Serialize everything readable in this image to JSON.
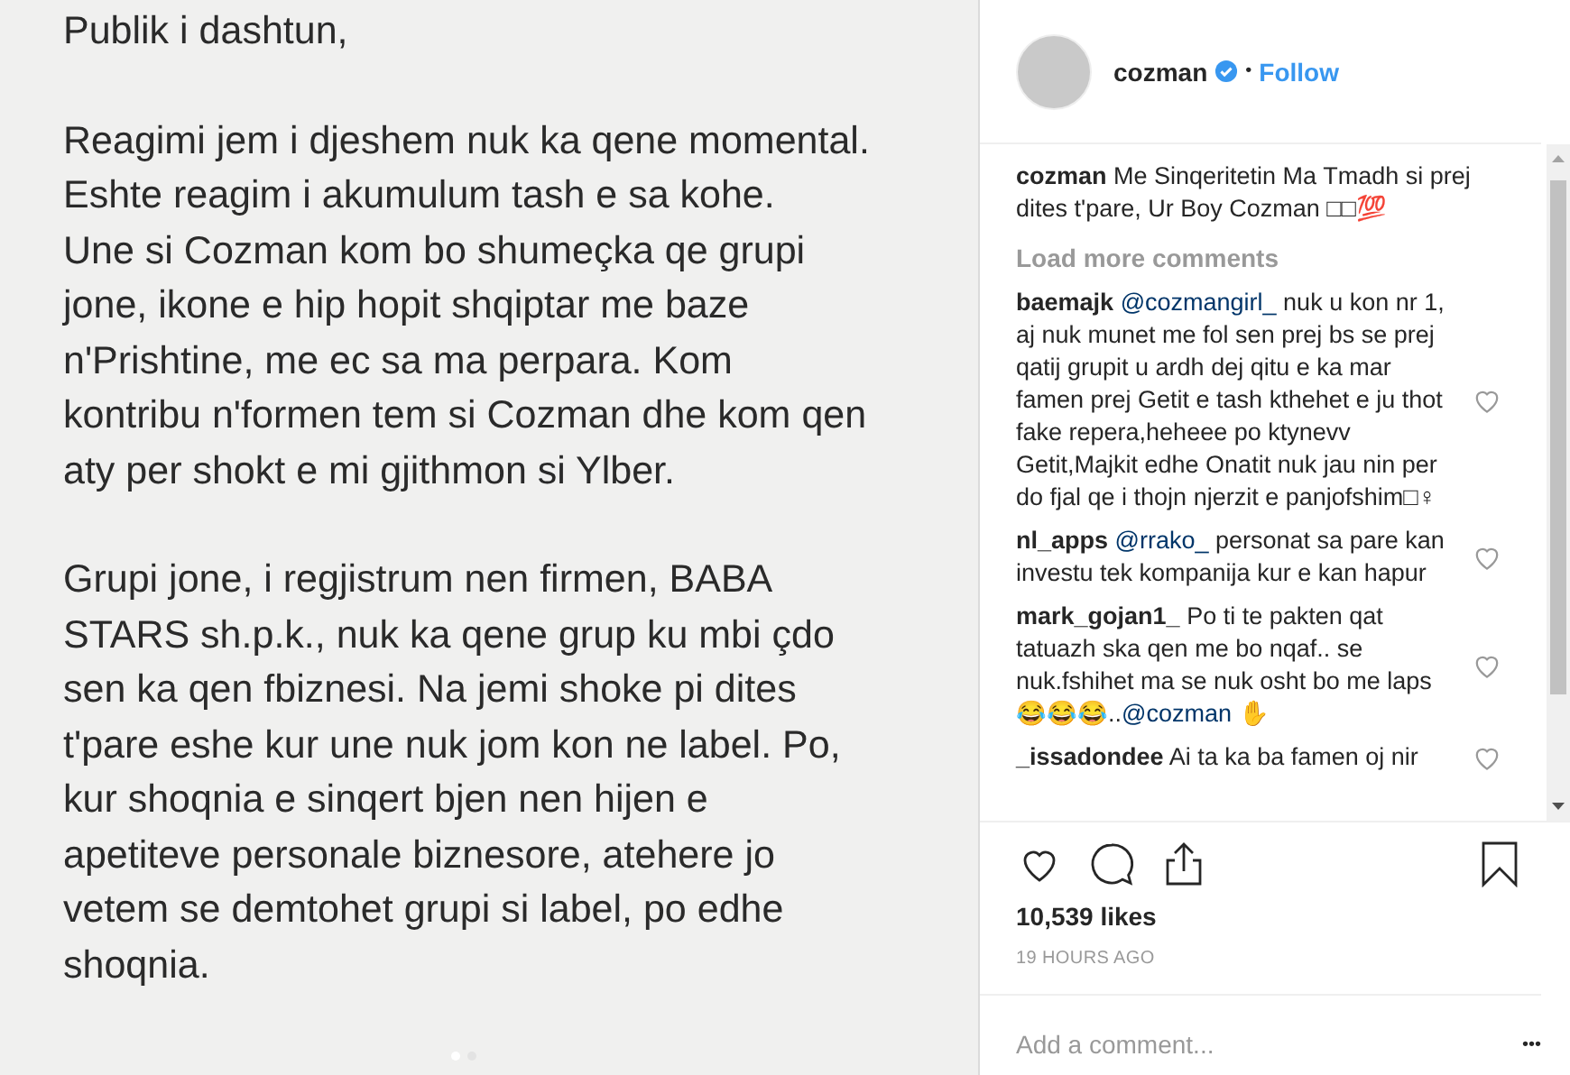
{
  "note": {
    "paragraphs": [
      [
        "Publik i dashtun,"
      ],
      [
        "Reagimi jem i djeshem nuk ka qene momental.",
        "Eshte reagim i akumulum tash e sa kohe.",
        "Une si Cozman kom bo shumeçka qe grupi",
        "jone, ikone e hip hopit shqiptar me baze",
        "n'Prishtine, me ec sa ma perpara. Kom",
        "kontribu n'formen tem si Cozman dhe kom qen",
        "aty per shokt e mi gjithmon si Ylber."
      ],
      [
        "Grupi jone, i regjistrum nen firmen, BABA",
        "STARS sh.p.k., nuk ka qene grup ku mbi çdo",
        "sen ka qen fbiznesi. Na jemi shoke pi dites",
        "t'pare eshe kur une nuk jom kon ne label. Po,",
        "kur shoqnia e sinqert bjen nen hijen e",
        "apetiteve personale biznesore, atehere jo",
        "vetem se demtohet grupi si label, po edhe",
        "shoqnia."
      ]
    ],
    "carousel": [
      {
        "selected": true
      },
      {
        "selected": false
      }
    ]
  },
  "header": {
    "username": "cozman",
    "verified": true,
    "separator": "•",
    "follow": "Follow"
  },
  "caption": {
    "username": "cozman",
    "text": "Me Sinqeritetin Ma Tmadh si prej dites t'pare, Ur Boy Cozman □□💯"
  },
  "load_more": "Load more comments",
  "comments": [
    {
      "username": "baemajk",
      "parts": [
        {
          "kind": "mention",
          "text": "@cozmangirl_"
        },
        {
          "kind": "text",
          "text": " nuk u kon nr 1, aj nuk munet me fol sen prej bs se prej qatij grupit u ardh dej qitu e ka mar famen prej Getit e tash kthehet e ju thot fake repera,heheee po ktynevv Getit,Majkit edhe Onatit nuk jau nin per do fjal qe i thojn njerzit e panjofshim□♀"
        }
      ],
      "liked": false
    },
    {
      "username": "nl_apps",
      "parts": [
        {
          "kind": "mention",
          "text": "@rrako_"
        },
        {
          "kind": "text",
          "text": " personat sa pare kan investu tek kompanija kur e kan hapur"
        }
      ],
      "liked": false
    },
    {
      "username": "mark_gojan1_",
      "parts": [
        {
          "kind": "text",
          "text": "Po ti te pakten qat tatuazh ska qen me bo nqaf.. se nuk.fshihet ma se nuk osht bo me laps 😂😂😂.."
        },
        {
          "kind": "mention",
          "text": "@cozman"
        },
        {
          "kind": "text",
          "text": " ✋"
        }
      ],
      "liked": false
    },
    {
      "username": "_issadondee",
      "parts": [
        {
          "kind": "text",
          "text": "Ai ta ka ba famen oj nir"
        }
      ],
      "liked": false
    }
  ],
  "actions": {
    "liked": false,
    "saved": false
  },
  "likes": "10,539 likes",
  "time": "19 HOURS AGO",
  "comment_field": {
    "placeholder": "Add a comment..."
  },
  "more": "•••"
}
